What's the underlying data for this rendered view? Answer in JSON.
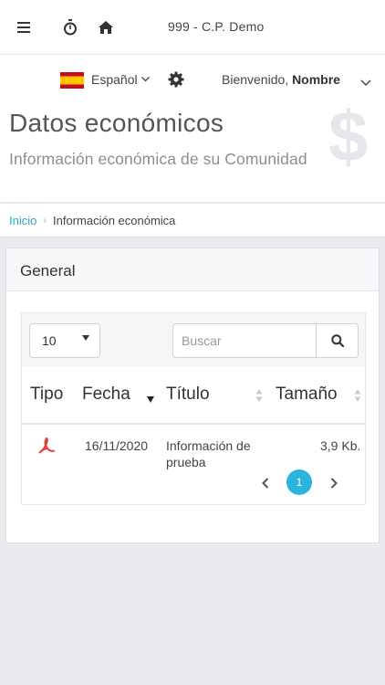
{
  "topbar": {
    "menu_icon": "hamburger-menu-icon",
    "timer_icon": "stopwatch-icon",
    "home_icon": "home-icon",
    "title": "999 - C.P. Demo"
  },
  "subbar": {
    "flag_icon": "spain-flag-icon",
    "language": "Español",
    "settings_icon": "gear-icon",
    "welcome_prefix": "Bienvenido,",
    "user_name": "Nombre"
  },
  "header": {
    "title": "Datos económicos",
    "subtitle": "Información económica de su Comunidad",
    "watermark_icon": "dollar-sign-icon",
    "watermark_glyph": "$"
  },
  "breadcrumb": {
    "home": "Inicio",
    "separator": "›",
    "current": "Información económica"
  },
  "panel": {
    "title": "General"
  },
  "table": {
    "page_length": "10",
    "search_placeholder": "Buscar",
    "columns": [
      "Tipo",
      "Fecha",
      "Título",
      "Tamaño"
    ],
    "rows": [
      {
        "type_icon": "pdf-icon",
        "date": "16/11/2020",
        "title_line1": "Información de",
        "title_line2": "prueba",
        "size": "3,9 Kb."
      }
    ],
    "pagination": {
      "current_page": "1"
    }
  },
  "colors": {
    "accent": "#2bb4dc",
    "link": "#2fa6c9",
    "pdf_red": "#e0403a",
    "background": "#e9ebee"
  }
}
